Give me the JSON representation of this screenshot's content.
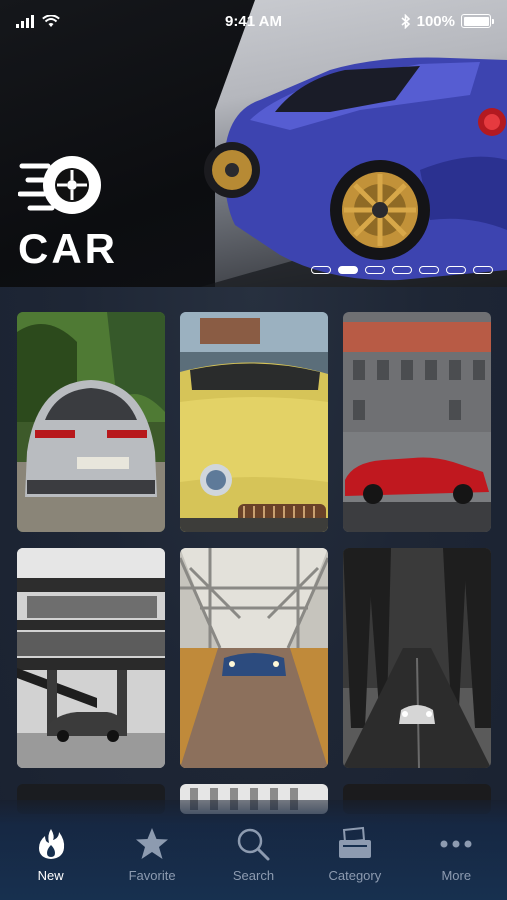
{
  "status": {
    "time": "9:41 AM",
    "battery": "100%"
  },
  "brand": {
    "name": "CAR"
  },
  "carousel": {
    "page_count": 7,
    "active_index": 1
  },
  "gallery": {
    "tiles": [
      {
        "subject": "silver sports car"
      },
      {
        "subject": "yellow convertible"
      },
      {
        "subject": "red car by building"
      },
      {
        "subject": "car under parking structure"
      },
      {
        "subject": "car on bridge"
      },
      {
        "subject": "car on forest road"
      }
    ]
  },
  "tabs": [
    {
      "label": "New",
      "icon": "flame-icon",
      "active": true
    },
    {
      "label": "Favorite",
      "icon": "star-icon",
      "active": false
    },
    {
      "label": "Search",
      "icon": "search-icon",
      "active": false
    },
    {
      "label": "Category",
      "icon": "folder-icon",
      "active": false
    },
    {
      "label": "More",
      "icon": "more-icon",
      "active": false
    }
  ],
  "colors": {
    "accent": "#ffffff",
    "inactive": "#8d9bb0",
    "background": "#1c2433"
  }
}
